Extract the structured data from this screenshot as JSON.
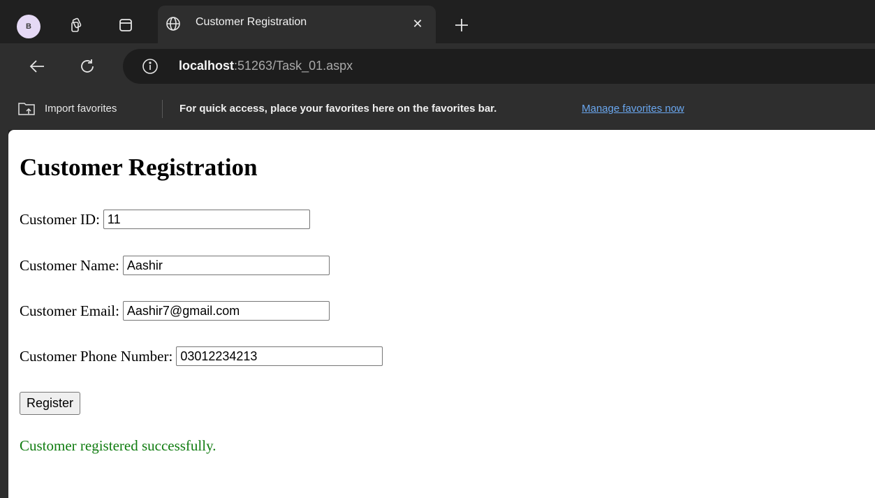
{
  "browser": {
    "profile_initial": "B",
    "tab": {
      "title": "Customer Registration",
      "close_glyph": "✕"
    },
    "new_tab_glyph": "+",
    "address": {
      "host": "localhost",
      "path": ":51263/Task_01.aspx"
    },
    "favorites_bar": {
      "import_label": "Import favorites",
      "hint": "For quick access, place your favorites here on the favorites bar.",
      "manage_link": "Manage favorites now"
    },
    "icons": [
      "workspaces-icon",
      "tab-actions-icon",
      "globe-icon",
      "back-icon",
      "refresh-icon",
      "info-icon",
      "import-favorites-icon"
    ]
  },
  "page": {
    "title": "Customer Registration",
    "fields": [
      {
        "label": "Customer ID:",
        "value": "11"
      },
      {
        "label": "Customer Name:",
        "value": "Aashir"
      },
      {
        "label": "Customer Email:",
        "value": "Aashir7@gmail.com"
      },
      {
        "label": "Customer Phone Number:",
        "value": "03012234213"
      }
    ],
    "register_button": "Register",
    "status_message": "Customer registered successfully.",
    "status_color": "#107c10"
  }
}
